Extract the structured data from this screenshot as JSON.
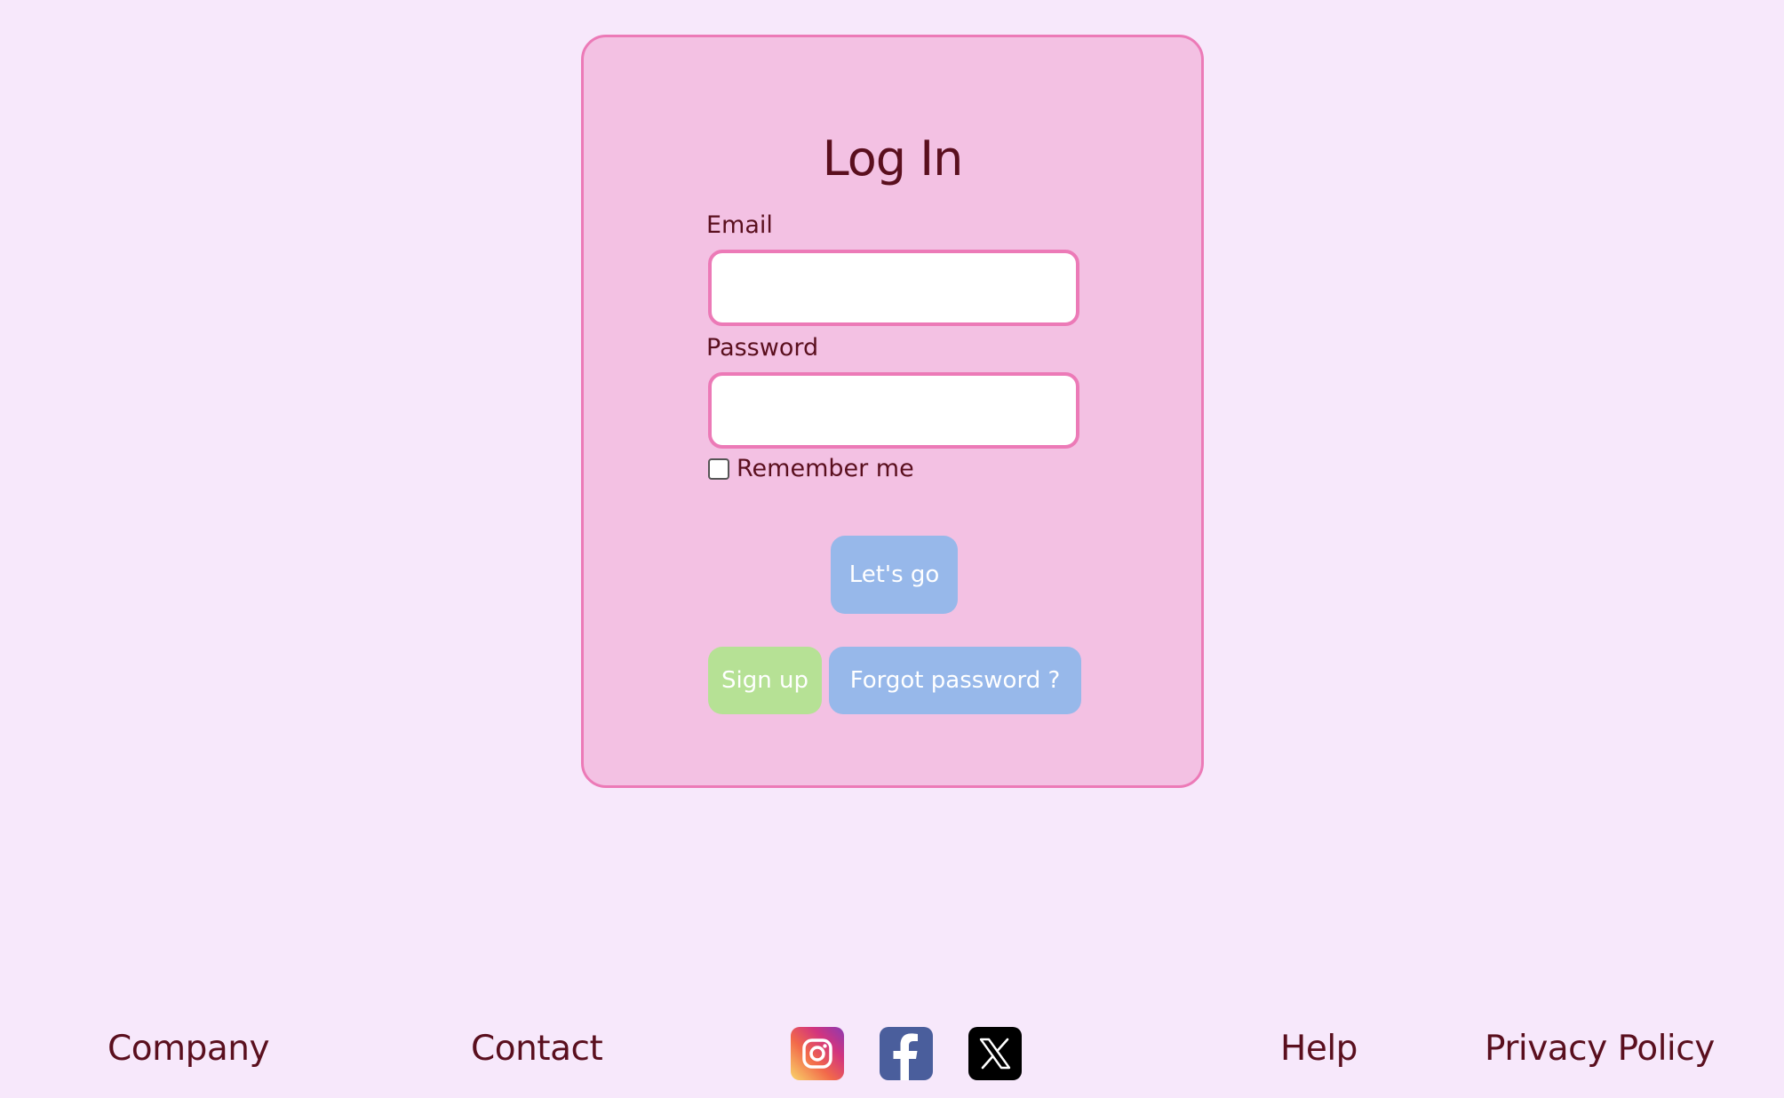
{
  "login": {
    "title": "Log In",
    "email_label": "Email",
    "email_value": "",
    "password_label": "Password",
    "password_value": "",
    "remember_label": "Remember me",
    "remember_checked": false,
    "submit_label": "Let's go",
    "signup_label": "Sign up",
    "forgot_label": "Forgot password ?"
  },
  "footer": {
    "company": "Company",
    "contact": "Contact",
    "help": "Help",
    "privacy": "Privacy Policy",
    "social_icons": [
      "instagram-icon",
      "facebook-icon",
      "x-icon"
    ]
  },
  "colors": {
    "page_background": "#f7e8fb",
    "card_background": "#f3c1e3",
    "card_border": "#ec7ab7",
    "text": "#5a0f1e",
    "primary_button": "#97b8ea",
    "signup_button": "#b6e195"
  }
}
